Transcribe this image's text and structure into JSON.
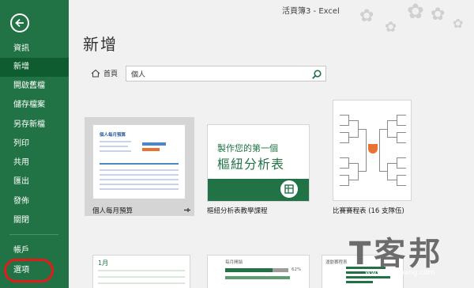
{
  "window": {
    "title": "活頁簿3 - Excel"
  },
  "sidebar": {
    "items": [
      {
        "label": "資訊",
        "active": false
      },
      {
        "label": "新增",
        "active": true
      },
      {
        "label": "開啟舊檔",
        "active": false
      },
      {
        "label": "儲存檔案",
        "active": false
      },
      {
        "label": "另存新檔",
        "active": false
      },
      {
        "label": "列印",
        "active": false
      },
      {
        "label": "共用",
        "active": false
      },
      {
        "label": "匯出",
        "active": false
      },
      {
        "label": "發佈",
        "active": false
      },
      {
        "label": "關閉",
        "active": false
      }
    ],
    "bottom": [
      {
        "label": "帳戶"
      },
      {
        "label": "選項"
      }
    ],
    "highlight_color": "#e31b1b"
  },
  "main": {
    "heading": "新增",
    "home_label": "首頁",
    "search": {
      "value": "個人",
      "placeholder": ""
    },
    "templates": [
      {
        "label": "個人每月預算",
        "pinned": true,
        "thumb_title": "個人每月預算",
        "selected": true
      },
      {
        "label": "樞紐分析表教學課程",
        "thumb_line1": "製作您的第一個",
        "thumb_line2": "樞紐分析表"
      },
      {
        "label": "比賽賽程表 (16 支隊伍)"
      }
    ],
    "row2_texts": {
      "a": "1月",
      "b": "每月開銷",
      "b_percent": "62%",
      "c": "運動賽程表"
    }
  },
  "colors": {
    "brand": "#217346",
    "brand_dark": "#0e5c2f",
    "accent": "#e97132",
    "link": "#2c5f9e"
  },
  "watermark": {
    "text": "T客邦",
    "url": "www.techbang.com"
  }
}
